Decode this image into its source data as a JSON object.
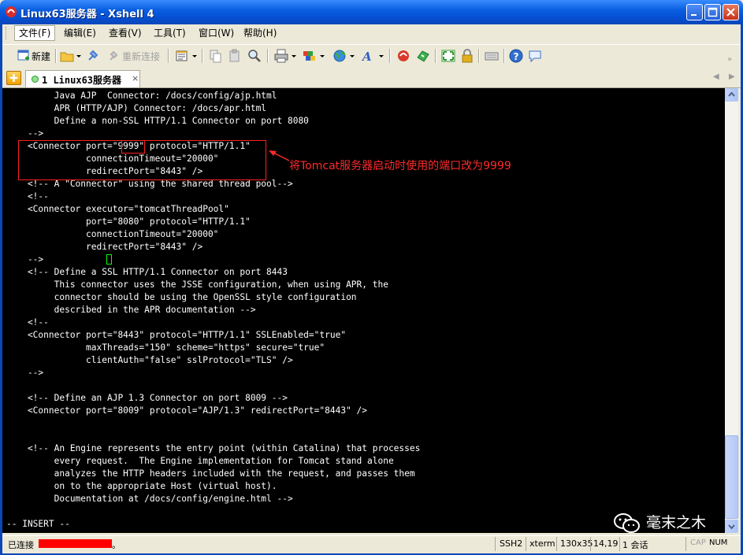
{
  "window": {
    "title": "Linux63服务器 - Xshell 4"
  },
  "menu": {
    "items": [
      "文件(F)",
      "编辑(E)",
      "查看(V)",
      "工具(T)",
      "窗口(W)",
      "帮助(H)"
    ]
  },
  "toolbar": {
    "new_label": "新建",
    "reconnect_label": "重新连接"
  },
  "tabs": [
    {
      "label": "1 Linux63服务器",
      "close": "×"
    }
  ],
  "terminal": {
    "lines": [
      "         Java AJP  Connector: /docs/config/ajp.html",
      "         APR (HTTP/AJP) Connector: /docs/apr.html",
      "         Define a non-SSL HTTP/1.1 Connector on port 8080",
      "    -->",
      "    <Connector port=\"9999\" protocol=\"HTTP/1.1\"",
      "               connectionTimeout=\"20000\"",
      "               redirectPort=\"8443\" />",
      "    <!-- A \"Connector\" using the shared thread pool-->",
      "    <!--",
      "    <Connector executor=\"tomcatThreadPool\"",
      "               port=\"8080\" protocol=\"HTTP/1.1\"",
      "               connectionTimeout=\"20000\"",
      "               redirectPort=\"8443\" />",
      "    -->",
      "    <!-- Define a SSL HTTP/1.1 Connector on port 8443",
      "         This connector uses the JSSE configuration, when using APR, the",
      "         connector should be using the OpenSSL style configuration",
      "         described in the APR documentation -->",
      "    <!--",
      "    <Connector port=\"8443\" protocol=\"HTTP/1.1\" SSLEnabled=\"true\"",
      "               maxThreads=\"150\" scheme=\"https\" secure=\"true\"",
      "               clientAuth=\"false\" sslProtocol=\"TLS\" />",
      "    -->",
      "",
      "    <!-- Define an AJP 1.3 Connector on port 8009 -->",
      "    <Connector port=\"8009\" protocol=\"AJP/1.3\" redirectPort=\"8443\" />",
      "",
      "",
      "    <!-- An Engine represents the entry point (within Catalina) that processes",
      "         every request.  The Engine implementation for Tomcat stand alone",
      "         analyzes the HTTP headers included with the request, and passes them",
      "         on to the appropriate Host (virtual host).",
      "         Documentation at /docs/config/engine.html -->",
      "",
      "-- INSERT --"
    ],
    "annotation": "将Tomcat服务器启动时使用的端口改为9999",
    "watermark": "毫末之木"
  },
  "status": {
    "connection": "已连接",
    "connection_suffix": "。",
    "protocol": "SSH2",
    "term": "xterm",
    "size": "130x35",
    "cursor_pos": "14,19",
    "sessions": "1 会话",
    "caps": "CAP",
    "num": "NUM"
  },
  "colors": {
    "title_bar": "#0a5fe0",
    "terminal_bg": "#000000",
    "terminal_fg": "#ffffff",
    "annotation": "#ff2a2a",
    "cursor": "#00ff00"
  }
}
